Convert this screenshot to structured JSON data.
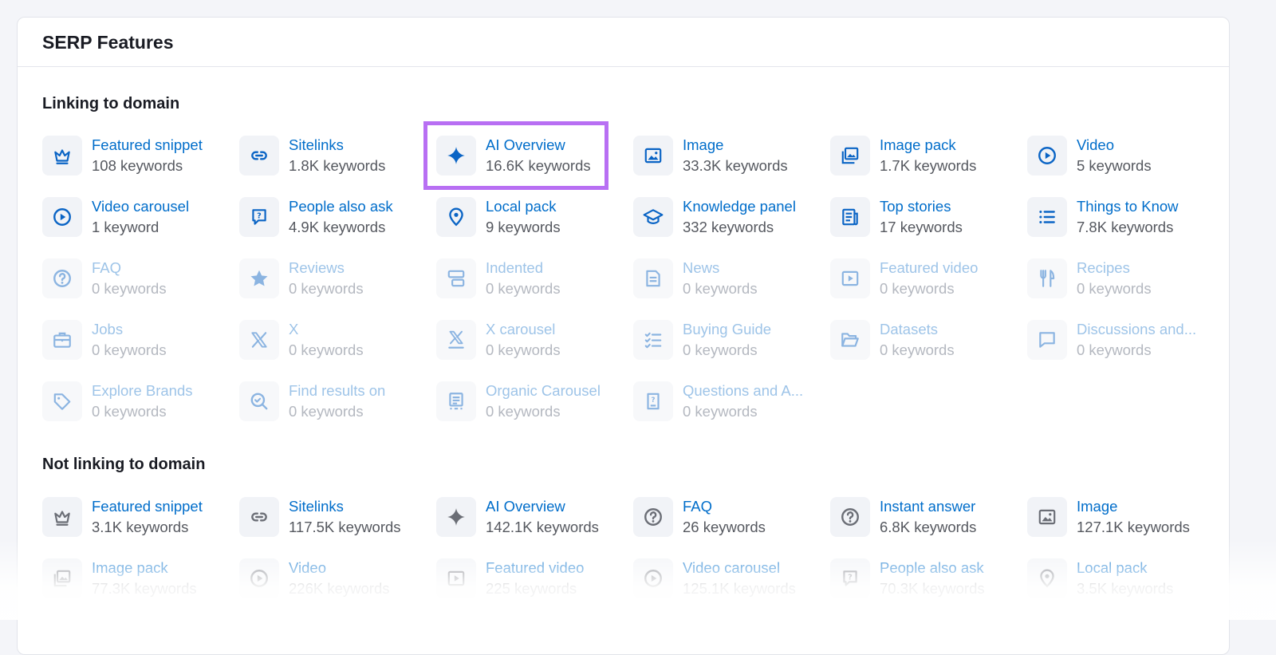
{
  "card": {
    "title": "SERP Features"
  },
  "linking": {
    "title": "Linking to domain",
    "items": [
      {
        "label": "Featured snippet",
        "sub": "108 keywords",
        "icon": "crown-icon",
        "dim": false
      },
      {
        "label": "Sitelinks",
        "sub": "1.8K keywords",
        "icon": "link-icon",
        "dim": false
      },
      {
        "label": "AI Overview",
        "sub": "16.6K keywords",
        "icon": "sparkle-icon",
        "dim": false
      },
      {
        "label": "Image",
        "sub": "33.3K keywords",
        "icon": "image-icon",
        "dim": false
      },
      {
        "label": "Image pack",
        "sub": "1.7K keywords",
        "icon": "image-pack-icon",
        "dim": false
      },
      {
        "label": "Video",
        "sub": "5 keywords",
        "icon": "play-circle-icon",
        "dim": false
      },
      {
        "label": "Video carousel",
        "sub": "1 keyword",
        "icon": "play-circle-icon",
        "dim": false
      },
      {
        "label": "People also ask",
        "sub": "4.9K keywords",
        "icon": "question-bubble-icon",
        "dim": false
      },
      {
        "label": "Local pack",
        "sub": "9 keywords",
        "icon": "location-pin-icon",
        "dim": false
      },
      {
        "label": "Knowledge panel",
        "sub": "332 keywords",
        "icon": "graduation-cap-icon",
        "dim": false
      },
      {
        "label": "Top stories",
        "sub": "17 keywords",
        "icon": "newspaper-icon",
        "dim": false
      },
      {
        "label": "Things to Know",
        "sub": "7.8K keywords",
        "icon": "list-icon",
        "dim": false
      },
      {
        "label": "FAQ",
        "sub": "0 keywords",
        "icon": "question-circle-icon",
        "dim": true
      },
      {
        "label": "Reviews",
        "sub": "0 keywords",
        "icon": "star-icon",
        "dim": true
      },
      {
        "label": "Indented",
        "sub": "0 keywords",
        "icon": "indented-icon",
        "dim": true
      },
      {
        "label": "News",
        "sub": "0 keywords",
        "icon": "news-icon",
        "dim": true
      },
      {
        "label": "Featured video",
        "sub": "0 keywords",
        "icon": "video-frame-icon",
        "dim": true
      },
      {
        "label": "Recipes",
        "sub": "0 keywords",
        "icon": "utensils-icon",
        "dim": true
      },
      {
        "label": "Jobs",
        "sub": "0 keywords",
        "icon": "briefcase-icon",
        "dim": true
      },
      {
        "label": "X",
        "sub": "0 keywords",
        "icon": "x-logo-icon",
        "dim": true
      },
      {
        "label": "X carousel",
        "sub": "0 keywords",
        "icon": "x-carousel-icon",
        "dim": true
      },
      {
        "label": "Buying Guide",
        "sub": "0 keywords",
        "icon": "checklist-icon",
        "dim": true
      },
      {
        "label": "Datasets",
        "sub": "0 keywords",
        "icon": "folder-open-icon",
        "dim": true
      },
      {
        "label": "Discussions and...",
        "sub": "0 keywords",
        "icon": "chat-bubble-icon",
        "dim": true
      },
      {
        "label": "Explore Brands",
        "sub": "0 keywords",
        "icon": "tag-icon",
        "dim": true
      },
      {
        "label": "Find results on",
        "sub": "0 keywords",
        "icon": "search-check-icon",
        "dim": true
      },
      {
        "label": "Organic Carousel",
        "sub": "0 keywords",
        "icon": "document-icon",
        "dim": true
      },
      {
        "label": "Questions and A...",
        "sub": "0 keywords",
        "icon": "question-book-icon",
        "dim": true
      }
    ]
  },
  "notlinking": {
    "title": "Not linking to domain",
    "items": [
      {
        "label": "Featured snippet",
        "sub": "3.1K keywords",
        "icon": "crown-icon",
        "dim": false
      },
      {
        "label": "Sitelinks",
        "sub": "117.5K keywords",
        "icon": "link-icon",
        "dim": false
      },
      {
        "label": "AI Overview",
        "sub": "142.1K keywords",
        "icon": "sparkle-icon",
        "dim": false
      },
      {
        "label": "FAQ",
        "sub": "26 keywords",
        "icon": "question-circle-icon",
        "dim": false
      },
      {
        "label": "Instant answer",
        "sub": "6.8K keywords",
        "icon": "question-circle-icon",
        "dim": false
      },
      {
        "label": "Image",
        "sub": "127.1K keywords",
        "icon": "image-icon",
        "dim": false
      },
      {
        "label": "Image pack",
        "sub": "77.3K keywords",
        "icon": "image-pack-icon",
        "dim": false
      },
      {
        "label": "Video",
        "sub": "226K keywords",
        "icon": "play-circle-icon",
        "dim": false
      },
      {
        "label": "Featured video",
        "sub": "225 keywords",
        "icon": "video-frame-icon",
        "dim": false
      },
      {
        "label": "Video carousel",
        "sub": "125.1K keywords",
        "icon": "play-circle-icon",
        "dim": false
      },
      {
        "label": "People also ask",
        "sub": "70.3K keywords",
        "icon": "question-bubble-icon",
        "dim": false
      },
      {
        "label": "Local pack",
        "sub": "3.5K keywords",
        "icon": "location-pin-icon",
        "dim": false
      }
    ]
  },
  "colors": {
    "link": "#006dca",
    "icon_active": "#0a64c5",
    "icon_gray": "#6b6e76",
    "highlight": "#b86ff3"
  }
}
